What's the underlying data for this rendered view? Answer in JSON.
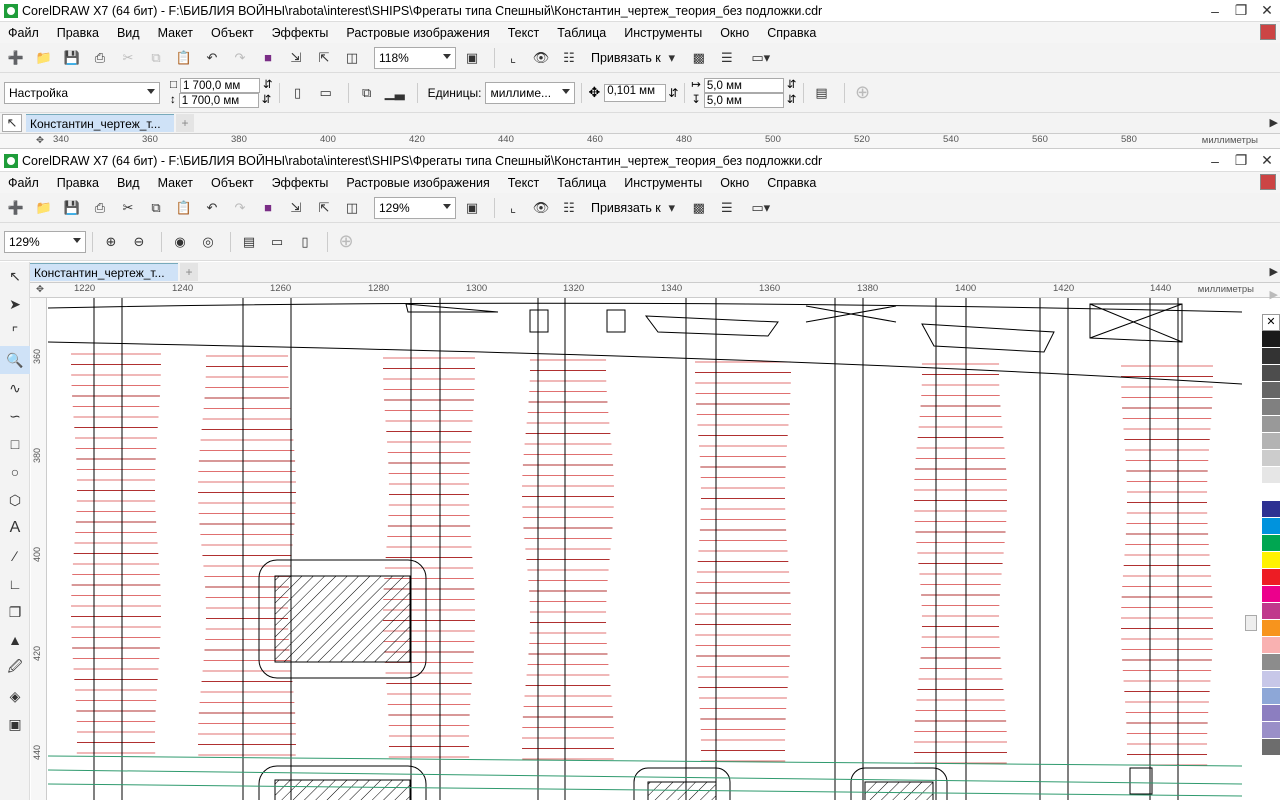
{
  "back_window": {
    "title": "CorelDRAW X7 (64 бит) - F:\\БИБЛИЯ ВОЙНЫ\\rabota\\interest\\SHIPS\\Фрегаты типа Спешный\\Константин_чертеж_теория_без подложки.cdr",
    "menu": [
      "Файл",
      "Правка",
      "Вид",
      "Макет",
      "Объект",
      "Эффекты",
      "Растровые изображения",
      "Текст",
      "Таблица",
      "Инструменты",
      "Окно",
      "Справка"
    ],
    "zoom": "118%",
    "snap_label": "Привязать к",
    "preset": "Настройка",
    "width": "1 700,0 мм",
    "height": "1 700,0 мм",
    "units_label": "Единицы:",
    "units_value": "миллиме...",
    "nudge": "0,101 мм",
    "dup_x": "5,0 мм",
    "dup_y": "5,0 мм",
    "tab": "Константин_чертеж_т...",
    "ruler_ticks": [
      "340",
      "360",
      "380",
      "400",
      "420",
      "440",
      "460",
      "480",
      "500",
      "520",
      "540",
      "560",
      "580"
    ],
    "ruler_unit": "миллиметры"
  },
  "front_window": {
    "title": "CorelDRAW X7 (64 бит) - F:\\БИБЛИЯ ВОЙНЫ\\rabota\\interest\\SHIPS\\Фрегаты типа Спешный\\Константин_чертеж_теория_без подложки.cdr",
    "menu": [
      "Файл",
      "Правка",
      "Вид",
      "Макет",
      "Объект",
      "Эффекты",
      "Растровые изображения",
      "Текст",
      "Таблица",
      "Инструменты",
      "Окно",
      "Справка"
    ],
    "zoom": "129%",
    "snap_label": "Привязать к",
    "zoom_prop": "129%",
    "tab": "Константин_чертеж_т...",
    "ruler_ticks": [
      "1220",
      "1240",
      "1260",
      "1280",
      "1300",
      "1320",
      "1340",
      "1360",
      "1380",
      "1400",
      "1420",
      "1440"
    ],
    "ruler_unit": "миллиметры",
    "vruler_ticks": [
      "360",
      "380",
      "400",
      "420",
      "440"
    ]
  },
  "palette_colors": [
    "#ffffff",
    "#1a1a1a",
    "#333333",
    "#4d4d4d",
    "#666666",
    "#808080",
    "#999999",
    "#b3b3b3",
    "#cccccc",
    "#e6e6e6",
    "#ffffff",
    "#2e3192",
    "#0093dd",
    "#00a651",
    "#fff200",
    "#ed1c24",
    "#ec008c",
    "#c0388c",
    "#f7941d",
    "#f9b1b1",
    "#8c8c8c",
    "#c7c7e8",
    "#8da7d7",
    "#8c7ec0",
    "#9a8fc8",
    "#6d6d6d"
  ]
}
